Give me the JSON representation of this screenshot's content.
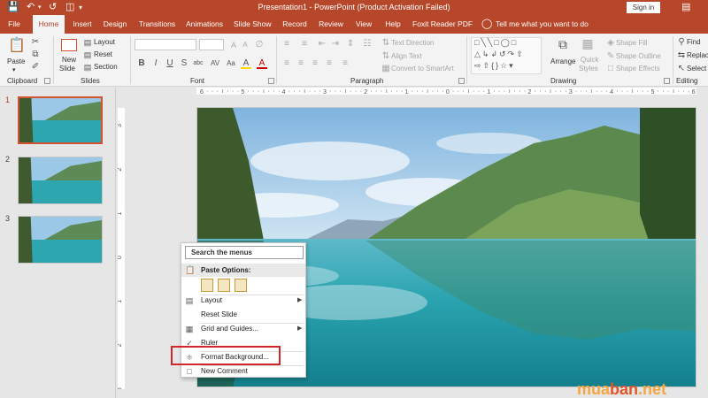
{
  "window": {
    "title": "Presentation1 - PowerPoint (Product Activation Failed)",
    "sign_in": "Sign in",
    "brand_color": "#b7472a"
  },
  "tabs": [
    "File",
    "Home",
    "Insert",
    "Design",
    "Transitions",
    "Animations",
    "Slide Show",
    "Record",
    "Review",
    "View",
    "Help",
    "Foxit Reader PDF",
    "Tell me what you want to do"
  ],
  "ribbon": {
    "clipboard": {
      "paste": "Paste",
      "label": "Clipboard"
    },
    "slides": {
      "new_slide_line1": "New",
      "new_slide_line2": "Slide",
      "layout": "Layout",
      "reset": "Reset",
      "section": "Section",
      "label": "Slides"
    },
    "font": {
      "bold": "B",
      "italic": "I",
      "underline": "U",
      "strike": "S",
      "shadow": "abc",
      "spacing": "AV",
      "case": "Aa",
      "highlight": "A",
      "label": "Font"
    },
    "paragraph": {
      "text_direction": "Text Direction",
      "align_text": "Align Text",
      "convert_smartart": "Convert to SmartArt",
      "label": "Paragraph"
    },
    "drawing": {
      "arrange": "Arrange",
      "quick_styles_1": "Quick",
      "quick_styles_2": "Styles",
      "shape_fill": "Shape Fill",
      "shape_outline": "Shape Outline",
      "shape_effects": "Shape Effects",
      "label": "Drawing"
    },
    "editing": {
      "find": "Find",
      "replace": "Replace",
      "select": "Select",
      "label": "Editing"
    }
  },
  "thumbnails": [
    {
      "number": "1",
      "selected": true
    },
    {
      "number": "2",
      "selected": false
    },
    {
      "number": "3",
      "selected": false
    }
  ],
  "rulers": {
    "horizontal": [
      "6",
      "5",
      "4",
      "3",
      "2",
      "1",
      "0",
      "1",
      "2",
      "3",
      "4",
      "5",
      "6"
    ],
    "vertical": [
      "3",
      "2",
      "1",
      "0",
      "1",
      "2",
      "3"
    ]
  },
  "context_menu": {
    "search": "Search the menus",
    "paste_options": "Paste Options:",
    "items": [
      {
        "label": "Layout",
        "has_submenu": true
      },
      {
        "label": "Reset Slide",
        "has_submenu": false
      },
      {
        "label": "Grid and Guides...",
        "has_submenu": true
      },
      {
        "label": "Ruler",
        "checked": true
      },
      {
        "label": "Format Background...",
        "highlighted": true
      },
      {
        "label": "New Comment"
      }
    ]
  },
  "watermark": {
    "part1": "mua",
    "part2": "ban",
    "part3": ".net"
  }
}
